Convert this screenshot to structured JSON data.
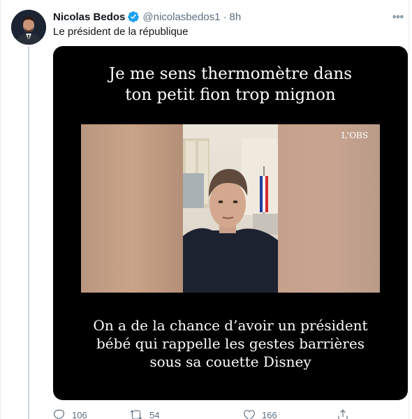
{
  "tweet": {
    "author_name": "Nicolas Bedos",
    "handle": "@nicolasbedos1",
    "separator": "·",
    "time": "8h",
    "text": "Le président de la république"
  },
  "media": {
    "caption_top_line1": "Je me sens thermomètre dans",
    "caption_top_line2": "ton petit fion trop mignon",
    "caption_bottom_line1": "On a de la chance d’avoir un président",
    "caption_bottom_line2": "bébé qui rappelle les gestes barrières",
    "caption_bottom_line3": "sous sa couette Disney",
    "watermark": "L'OBS"
  },
  "actions": {
    "reply_count": "106",
    "retweet_count": "54",
    "like_count": "166"
  },
  "colors": {
    "verified": "#1da1f2",
    "secondary_text": "#5b7083",
    "media_background": "#000000"
  },
  "icons": [
    "verified-badge-icon",
    "more-options-icon",
    "reply-icon",
    "retweet-icon",
    "like-icon",
    "share-icon"
  ]
}
